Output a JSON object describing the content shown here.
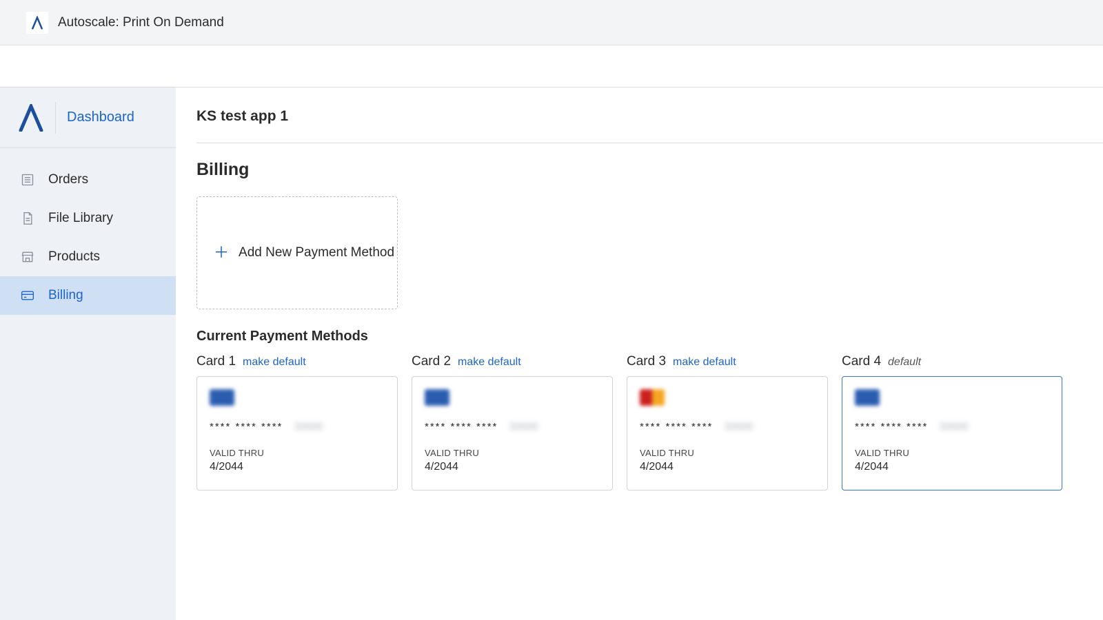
{
  "header": {
    "app_title": "Autoscale: Print On Demand"
  },
  "sidebar": {
    "brand_link": "Dashboard",
    "items": [
      {
        "label": "Orders"
      },
      {
        "label": "File Library"
      },
      {
        "label": "Products"
      },
      {
        "label": "Billing"
      }
    ]
  },
  "page": {
    "app_name": "KS test app 1",
    "section_title": "Billing",
    "add_payment_label": "Add New Payment Method",
    "current_methods_title": "Current Payment Methods",
    "make_default_label": "make default",
    "default_label": "default",
    "valid_thru_label": "VALID THRU",
    "cards": [
      {
        "title": "Card 1",
        "brand": "visa",
        "mask": "****  ****  ****",
        "last4": "0000",
        "exp": "4/2044",
        "is_default": false
      },
      {
        "title": "Card 2",
        "brand": "visa",
        "mask": "****  ****  ****",
        "last4": "0000",
        "exp": "4/2044",
        "is_default": false
      },
      {
        "title": "Card 3",
        "brand": "mc",
        "mask": "****  ****  ****",
        "last4": "0000",
        "exp": "4/2044",
        "is_default": false
      },
      {
        "title": "Card 4",
        "brand": "visa",
        "mask": "****  ****  ****",
        "last4": "0000",
        "exp": "4/2044",
        "is_default": true
      }
    ]
  }
}
